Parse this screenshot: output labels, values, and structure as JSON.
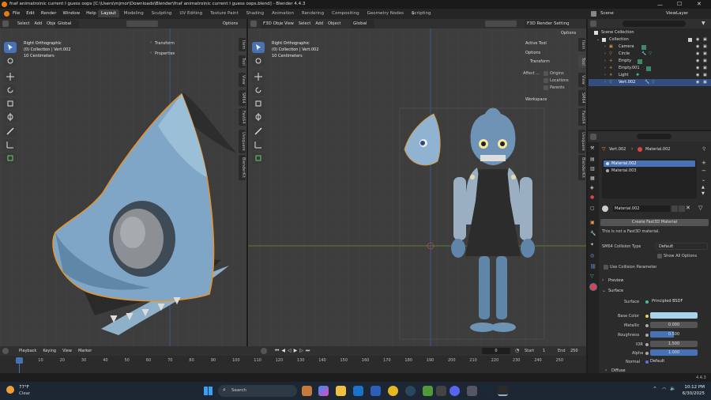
{
  "window": {
    "title": "fnaf animatroinic current I guess oops [C:\\Users\\mjmor\\Downloads\\Blender\\fnaf animatroinic current I guess oops.blend] - Blender 4.4.3"
  },
  "menu": [
    "File",
    "Edit",
    "Render",
    "Window",
    "Help"
  ],
  "workspace_tabs": [
    "Layout",
    "Modeling",
    "Sculpting",
    "UV Editing",
    "Texture Paint",
    "Shading",
    "Animation",
    "Rendering",
    "Compositing",
    "Geometry Nodes",
    "Scripting"
  ],
  "scene": {
    "name": "Scene",
    "view_layer": "ViewLayer"
  },
  "left_viewport": {
    "menus": [
      "Select",
      "Add",
      "Object"
    ],
    "orientation": "Global",
    "options_label": "Options",
    "view_name": "Right Orthographic",
    "collection_info": "(0) Collection | Vert.002",
    "scale": "10 Centimeters",
    "panels": [
      "Transform",
      "Properties"
    ],
    "side_tabs": [
      "Item",
      "Tool",
      "View",
      "SM64",
      "Fast64",
      "Uvsquare",
      "BlenderKit"
    ]
  },
  "right_viewport": {
    "mode": "F3D Object Mode",
    "menus": [
      "View",
      "Select",
      "Add",
      "Object"
    ],
    "orientation": "Global",
    "render_settings": "F3D Render Settings",
    "options_label": "Options",
    "view_name": "Right Orthographic",
    "collection_info": "(0) Collection | Vert.002",
    "scale": "10 Centimeters",
    "active_tool": "Active Tool",
    "options_header": "Options",
    "transform_header": "Transform",
    "affect_only": "Affect ...",
    "checkboxes": [
      "Origins",
      "Locations",
      "Parents"
    ],
    "workspace_label": "Workspace",
    "side_tabs": [
      "Item",
      "Tool",
      "View",
      "SM64",
      "Fast64",
      "Uvsquare",
      "BlenderKit"
    ]
  },
  "outliner": {
    "root": "Scene Collection",
    "collection": "Collection",
    "items": [
      "Camera",
      "Circle",
      "Empty",
      "Empty.001",
      "Light",
      "Vert.002"
    ],
    "search_placeholder": ""
  },
  "properties": {
    "breadcrumb_object": "Vert.002",
    "breadcrumb_material": "Material.002",
    "material_slots": [
      "Material.002",
      "Material.003"
    ],
    "material_name": "Material.002",
    "fast3d_button": "Create Fast3D Material",
    "fast3d_note": "This is not a Fast3D material.",
    "collision_label": "SM64 Collision Type",
    "collision_value": "Default",
    "show_all_options": "Show All Options",
    "use_collision": "Use Collision Parameter",
    "preview": "Preview",
    "surface": "Surface",
    "surface_label": "Surface",
    "surface_value": "Principled BSDF",
    "rows": [
      {
        "label": "Base Color",
        "value": ""
      },
      {
        "label": "Metallic",
        "value": "0.000"
      },
      {
        "label": "Roughness",
        "value": "0.500"
      },
      {
        "label": "IOR",
        "value": "1.500"
      },
      {
        "label": "Alpha",
        "value": "1.000"
      },
      {
        "label": "Normal",
        "value": "Default"
      }
    ],
    "diffuse": "Diffuse",
    "base_color_hex": "#a8d4ea"
  },
  "timeline": {
    "menus": [
      "Playback",
      "Keying",
      "View",
      "Marker"
    ],
    "current_frame": "0",
    "start_label": "Start",
    "start": "1",
    "end_label": "End",
    "end": "250",
    "ticks": [
      "0",
      "10",
      "20",
      "30",
      "40",
      "50",
      "60",
      "70",
      "80",
      "90",
      "100",
      "110",
      "120",
      "130",
      "140",
      "150",
      "160",
      "170",
      "180",
      "190",
      "200",
      "210",
      "220",
      "230",
      "240",
      "250"
    ]
  },
  "status_version": "4.4.3",
  "taskbar": {
    "weather_temp": "77°F",
    "weather_desc": "Clear",
    "search_label": "Search",
    "time": "10:12 PM",
    "date": "6/30/2025"
  },
  "colors": {
    "accent": "#4772b3",
    "orange": "#f5a623",
    "wire": "#e8922a"
  }
}
